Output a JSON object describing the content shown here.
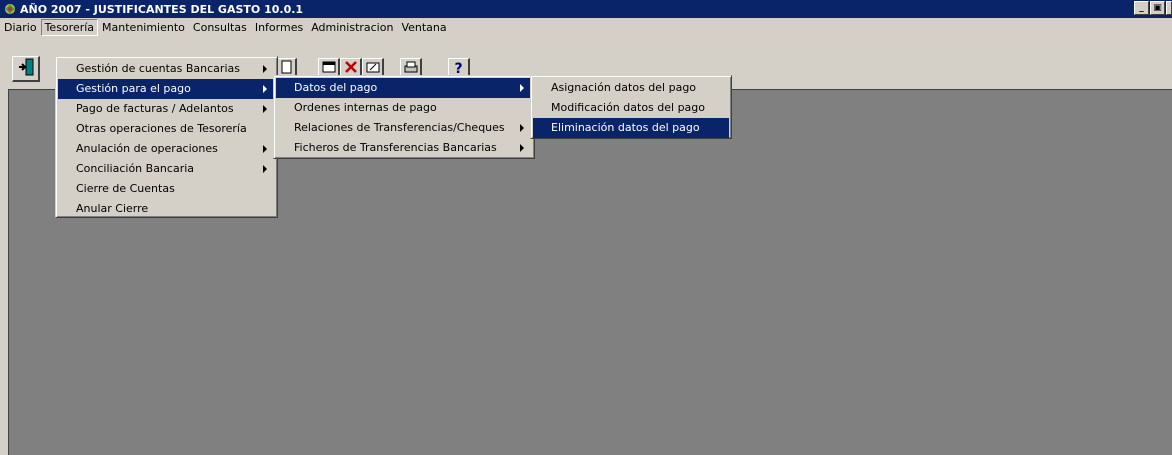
{
  "window": {
    "title": "AÑO 2007 - JUSTIFICANTES DEL GASTO 10.0.1",
    "minimize_glyph": "_",
    "maximize_glyph": "▣"
  },
  "menubar": {
    "items": [
      "Diario",
      "Tesorería",
      "Mantenimiento",
      "Consultas",
      "Informes",
      "Administracion",
      "Ventana"
    ],
    "active": "Tesorería"
  },
  "tesoreria_menu": {
    "items": [
      {
        "label": "Gestión de cuentas Bancarias",
        "submenu": true
      },
      {
        "label": "Gestión para el pago",
        "submenu": true,
        "selected": true
      },
      {
        "label": "Pago de facturas / Adelantos",
        "submenu": true
      },
      {
        "label": "Otras operaciones de Tesorería",
        "submenu": false
      },
      {
        "label": "Anulación de operaciones",
        "submenu": true
      },
      {
        "label": "Conciliación Bancaria",
        "submenu": true
      },
      {
        "label": "Cierre de Cuentas",
        "submenu": false
      },
      {
        "label": "Anular Cierre",
        "submenu": false
      }
    ]
  },
  "gestion_pago_menu": {
    "items": [
      {
        "label": "Datos del pago",
        "submenu": true,
        "selected": true
      },
      {
        "label": "Ordenes internas de pago",
        "submenu": false
      },
      {
        "label": "Relaciones de Transferencias/Cheques",
        "submenu": true
      },
      {
        "label": "Ficheros de Transferencias Bancarias",
        "submenu": true
      }
    ]
  },
  "datos_pago_menu": {
    "items": [
      {
        "label": "Asignación datos del pago",
        "selected": false
      },
      {
        "label": "Modificación datos del pago",
        "selected": false
      },
      {
        "label": "Eliminación datos del pago",
        "selected": true
      }
    ]
  },
  "toolbar": {
    "icons": [
      "exit-icon",
      "new-document-icon",
      "window-icon",
      "delete-icon",
      "edit-icon",
      "print-icon",
      "help-icon"
    ],
    "help_glyph": "?"
  },
  "colors": {
    "titlebar": "#0a246a",
    "selection": "#0a246a",
    "workspace": "#808080",
    "face": "#d4d0c8"
  }
}
